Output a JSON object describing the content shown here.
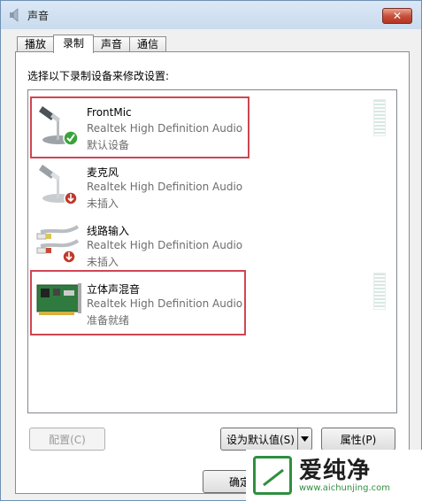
{
  "window": {
    "title": "声音",
    "close_symbol": "✕"
  },
  "tabs": [
    {
      "label": "播放",
      "active": false
    },
    {
      "label": "录制",
      "active": true
    },
    {
      "label": "声音",
      "active": false
    },
    {
      "label": "通信",
      "active": false
    }
  ],
  "instruction": "选择以下录制设备来修改设置:",
  "devices": [
    {
      "name": "FrontMic",
      "driver": "Realtek High Definition Audio",
      "status": "默认设备",
      "icon": "microphone-icon",
      "badge": "default-check-icon",
      "highlighted": true,
      "level_meter": true
    },
    {
      "name": "麦克风",
      "driver": "Realtek High Definition Audio",
      "status": "未插入",
      "icon": "microphone-icon",
      "badge": "unplugged-icon",
      "highlighted": false,
      "level_meter": false
    },
    {
      "name": "线路输入",
      "driver": "Realtek High Definition Audio",
      "status": "未插入",
      "icon": "line-in-cable-icon",
      "badge": "unplugged-icon",
      "highlighted": false,
      "level_meter": false
    },
    {
      "name": "立体声混音",
      "driver": "Realtek High Definition Audio",
      "status": "准备就绪",
      "icon": "sound-card-icon",
      "badge": "",
      "highlighted": true,
      "level_meter": true
    }
  ],
  "buttons": {
    "configure": "配置(C)",
    "set_default": "设为默认值(S)",
    "properties": "属性(P)",
    "ok": "确定"
  },
  "watermark": {
    "brand": "爱纯净",
    "url": "www.aichunjing.com"
  },
  "colors": {
    "highlight": "#d04552",
    "check": "#3aa33a",
    "unplugged": "#c0392b"
  }
}
